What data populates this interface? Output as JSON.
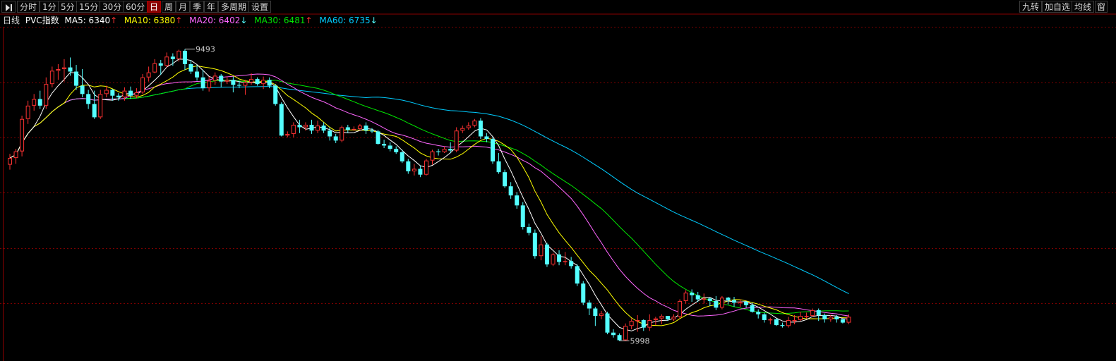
{
  "toolbar": {
    "periods": [
      "分时",
      "1分",
      "5分",
      "15分",
      "30分",
      "60分",
      "日",
      "周",
      "月",
      "季",
      "年",
      "多周期",
      "设置"
    ],
    "active_period": "日",
    "right_buttons": [
      "九转",
      "加自选",
      "均线",
      "窗"
    ]
  },
  "legend": {
    "period": "日线",
    "instrument": "PVC指数",
    "ma5": {
      "label": "MA5: 6340",
      "arrow": "↑",
      "color": "#ffffff"
    },
    "ma10": {
      "label": "MA10: 6380",
      "arrow": "↑",
      "color": "#ffff00"
    },
    "ma20": {
      "label": "MA20: 6402",
      "arrow": "↓",
      "color": "#ff66ff"
    },
    "ma30": {
      "label": "MA30: 6481",
      "arrow": "↑",
      "color": "#00e600"
    },
    "ma60": {
      "label": "MA60: 6735",
      "arrow": "↓",
      "color": "#00ccff"
    }
  },
  "colors": {
    "up": "#ff3232",
    "down": "#54ffff",
    "grid": "#7a0000",
    "arrow_up": "#ff3232",
    "arrow_down": "#54ffff"
  },
  "chart_data": {
    "type": "candlestick",
    "y_range": [
      5850,
      9650
    ],
    "max_label": "9493",
    "min_label": "5998",
    "candles": [
      [
        8110,
        8190,
        8050,
        8240
      ],
      [
        8190,
        8270,
        8120,
        8300
      ],
      [
        8270,
        8660,
        8210,
        8700
      ],
      [
        8660,
        8820,
        8600,
        8880
      ],
      [
        8820,
        8900,
        8760,
        8960
      ],
      [
        8900,
        8820,
        8780,
        9000
      ],
      [
        8820,
        9080,
        8780,
        9160
      ],
      [
        9080,
        9240,
        9040,
        9290
      ],
      [
        9240,
        9260,
        9130,
        9320
      ],
      [
        9260,
        9280,
        9110,
        9380
      ],
      [
        9280,
        9230,
        9180,
        9400
      ],
      [
        9230,
        9060,
        9010,
        9310
      ],
      [
        9060,
        8960,
        8920,
        9260
      ],
      [
        8960,
        8840,
        8780,
        9010
      ],
      [
        8840,
        8680,
        8660,
        9000
      ],
      [
        8680,
        8960,
        8660,
        9010
      ],
      [
        8960,
        9010,
        8920,
        9060
      ],
      [
        9010,
        8940,
        8880,
        9020
      ],
      [
        8940,
        8920,
        8880,
        8970
      ],
      [
        8920,
        9000,
        8880,
        9040
      ],
      [
        9000,
        8940,
        8900,
        9050
      ],
      [
        8940,
        8980,
        8910,
        9030
      ],
      [
        8980,
        9160,
        8960,
        9200
      ],
      [
        9160,
        9220,
        9110,
        9290
      ],
      [
        9220,
        9330,
        9210,
        9380
      ],
      [
        9330,
        9300,
        9190,
        9370
      ],
      [
        9300,
        9410,
        9280,
        9460
      ],
      [
        9410,
        9380,
        9300,
        9450
      ],
      [
        9380,
        9480,
        9350,
        9493
      ],
      [
        9480,
        9320,
        9250,
        9500
      ],
      [
        9320,
        9230,
        9200,
        9370
      ],
      [
        9230,
        9160,
        9120,
        9310
      ],
      [
        9160,
        9030,
        9000,
        9250
      ],
      [
        9030,
        9120,
        8990,
        9170
      ],
      [
        9120,
        9180,
        9070,
        9220
      ],
      [
        9180,
        9110,
        9040,
        9200
      ],
      [
        9110,
        9130,
        9080,
        9170
      ],
      [
        9130,
        9070,
        8980,
        9170
      ],
      [
        9070,
        9060,
        9030,
        9120
      ],
      [
        9060,
        9100,
        8950,
        9130
      ],
      [
        9100,
        9140,
        9070,
        9210
      ],
      [
        9140,
        9080,
        9060,
        9160
      ],
      [
        9080,
        9130,
        9020,
        9170
      ],
      [
        9130,
        9060,
        9030,
        9160
      ],
      [
        9060,
        8840,
        8820,
        9080
      ],
      [
        8840,
        8460,
        8450,
        8860
      ],
      [
        8460,
        8480,
        8440,
        8510
      ],
      [
        8480,
        8590,
        8440,
        8620
      ],
      [
        8590,
        8560,
        8490,
        8650
      ],
      [
        8560,
        8590,
        8520,
        8620
      ],
      [
        8590,
        8520,
        8480,
        8650
      ],
      [
        8520,
        8580,
        8490,
        8640
      ],
      [
        8580,
        8520,
        8490,
        8620
      ],
      [
        8520,
        8450,
        8400,
        8560
      ],
      [
        8450,
        8400,
        8370,
        8480
      ],
      [
        8400,
        8560,
        8380,
        8580
      ],
      [
        8560,
        8530,
        8490,
        8590
      ],
      [
        8530,
        8540,
        8520,
        8570
      ],
      [
        8540,
        8580,
        8520,
        8600
      ],
      [
        8580,
        8520,
        8480,
        8620
      ],
      [
        8520,
        8510,
        8490,
        8550
      ],
      [
        8510,
        8360,
        8350,
        8530
      ],
      [
        8360,
        8340,
        8310,
        8410
      ],
      [
        8340,
        8300,
        8270,
        8380
      ],
      [
        8300,
        8260,
        8240,
        8330
      ],
      [
        8260,
        8150,
        8130,
        8290
      ],
      [
        8150,
        8030,
        8000,
        8180
      ],
      [
        8030,
        8060,
        7980,
        8120
      ],
      [
        8060,
        7990,
        7960,
        8100
      ],
      [
        7990,
        8160,
        7980,
        8180
      ],
      [
        8160,
        8270,
        8110,
        8290
      ],
      [
        8270,
        8260,
        8220,
        8300
      ],
      [
        8260,
        8300,
        8250,
        8330
      ],
      [
        8300,
        8280,
        8250,
        8380
      ],
      [
        8280,
        8520,
        8260,
        8560
      ],
      [
        8520,
        8550,
        8490,
        8580
      ],
      [
        8550,
        8580,
        8530,
        8620
      ],
      [
        8580,
        8640,
        8560,
        8660
      ],
      [
        8640,
        8450,
        8420,
        8670
      ],
      [
        8450,
        8420,
        8380,
        8490
      ],
      [
        8420,
        8150,
        8120,
        8440
      ],
      [
        8150,
        8020,
        8000,
        8250
      ],
      [
        8020,
        7850,
        7830,
        8050
      ],
      [
        7850,
        7740,
        7700,
        7900
      ],
      [
        7740,
        7620,
        7580,
        7780
      ],
      [
        7620,
        7360,
        7330,
        7660
      ],
      [
        7360,
        7290,
        7260,
        7400
      ],
      [
        7290,
        7010,
        6980,
        7330
      ],
      [
        7010,
        7150,
        6960,
        7250
      ],
      [
        7150,
        6910,
        6880,
        7170
      ],
      [
        6910,
        7030,
        6890,
        7050
      ],
      [
        7030,
        6940,
        6900,
        7080
      ],
      [
        6940,
        6950,
        6900,
        7060
      ],
      [
        6950,
        6890,
        6860,
        7000
      ],
      [
        6890,
        6680,
        6650,
        6910
      ],
      [
        6680,
        6450,
        6420,
        6710
      ],
      [
        6450,
        6380,
        6300,
        6480
      ],
      [
        6380,
        6290,
        6170,
        6400
      ],
      [
        6290,
        6320,
        6250,
        6350
      ],
      [
        6320,
        6090,
        6070,
        6340
      ],
      [
        6090,
        6060,
        6030,
        6130
      ],
      [
        6060,
        5998,
        5990,
        6080
      ],
      [
        5998,
        6170,
        5990,
        6200
      ],
      [
        6170,
        6230,
        6130,
        6260
      ],
      [
        6230,
        6240,
        6100,
        6300
      ],
      [
        6240,
        6150,
        6110,
        6250
      ],
      [
        6150,
        6240,
        6110,
        6310
      ],
      [
        6240,
        6260,
        6180,
        6280
      ],
      [
        6260,
        6290,
        6190,
        6310
      ],
      [
        6290,
        6250,
        6230,
        6290
      ],
      [
        6250,
        6280,
        6230,
        6310
      ],
      [
        6280,
        6470,
        6260,
        6490
      ],
      [
        6470,
        6570,
        6440,
        6600
      ],
      [
        6570,
        6540,
        6460,
        6610
      ],
      [
        6540,
        6490,
        6460,
        6580
      ],
      [
        6490,
        6500,
        6440,
        6560
      ],
      [
        6500,
        6470,
        6410,
        6510
      ],
      [
        6470,
        6390,
        6360,
        6530
      ],
      [
        6390,
        6510,
        6370,
        6530
      ],
      [
        6510,
        6480,
        6430,
        6520
      ],
      [
        6480,
        6450,
        6400,
        6520
      ],
      [
        6450,
        6460,
        6400,
        6490
      ],
      [
        6460,
        6420,
        6390,
        6470
      ],
      [
        6420,
        6340,
        6330,
        6450
      ],
      [
        6340,
        6310,
        6260,
        6370
      ],
      [
        6310,
        6240,
        6210,
        6330
      ],
      [
        6240,
        6250,
        6190,
        6270
      ],
      [
        6250,
        6180,
        6170,
        6260
      ],
      [
        6180,
        6170,
        6150,
        6210
      ],
      [
        6170,
        6240,
        6150,
        6280
      ],
      [
        6240,
        6240,
        6190,
        6300
      ],
      [
        6240,
        6290,
        6230,
        6340
      ],
      [
        6290,
        6290,
        6260,
        6330
      ],
      [
        6290,
        6360,
        6280,
        6380
      ],
      [
        6360,
        6300,
        6230,
        6380
      ],
      [
        6300,
        6250,
        6210,
        6320
      ],
      [
        6250,
        6280,
        6220,
        6300
      ],
      [
        6280,
        6250,
        6210,
        6300
      ],
      [
        6250,
        6210,
        6200,
        6250
      ],
      [
        6210,
        6280,
        6190,
        6310
      ]
    ]
  }
}
